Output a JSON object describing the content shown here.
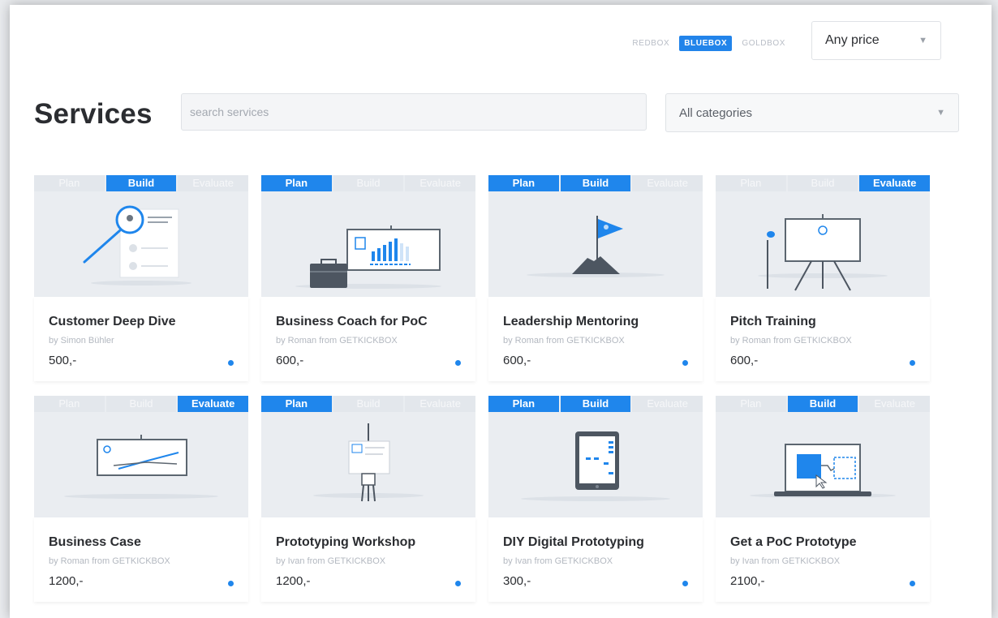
{
  "boxes": [
    {
      "label": "REDBOX",
      "active": false
    },
    {
      "label": "BLUEBOX",
      "active": true
    },
    {
      "label": "GOLDBOX",
      "active": false
    }
  ],
  "price_filter": {
    "value": "Any price"
  },
  "page_title": "Services",
  "search": {
    "placeholder": "search services"
  },
  "category_filter": {
    "value": "All categories"
  },
  "phase_labels": [
    "Plan",
    "Build",
    "Evaluate"
  ],
  "colors": {
    "accent": "#1f86ec"
  },
  "services": [
    {
      "title": "Customer Deep Dive",
      "author": "by Simon Bühler",
      "price": "500,-",
      "phases": [
        false,
        true,
        false
      ],
      "icon": "magnifier-profile-icon"
    },
    {
      "title": "Business Coach for PoC",
      "author": "by Roman from GETKICKBOX",
      "price": "600,-",
      "phases": [
        true,
        false,
        false
      ],
      "icon": "briefcase-chart-icon"
    },
    {
      "title": "Leadership Mentoring",
      "author": "by Roman from GETKICKBOX",
      "price": "600,-",
      "phases": [
        true,
        true,
        false
      ],
      "icon": "mountain-flag-icon"
    },
    {
      "title": "Pitch Training",
      "author": "by Roman from GETKICKBOX",
      "price": "600,-",
      "phases": [
        false,
        false,
        true
      ],
      "icon": "flipchart-microphone-icon"
    },
    {
      "title": "Business Case",
      "author": "by Roman from GETKICKBOX",
      "price": "1200,-",
      "phases": [
        false,
        false,
        true
      ],
      "icon": "line-chart-board-icon"
    },
    {
      "title": "Prototyping Workshop",
      "author": "by Ivan from GETKICKBOX",
      "price": "1200,-",
      "phases": [
        true,
        false,
        false
      ],
      "icon": "easel-workshop-icon"
    },
    {
      "title": "DIY Digital Prototyping",
      "author": "by Ivan from GETKICKBOX",
      "price": "300,-",
      "phases": [
        true,
        true,
        false
      ],
      "icon": "tablet-wireframe-icon"
    },
    {
      "title": "Get a PoC Prototype",
      "author": "by Ivan from GETKICKBOX",
      "price": "2100,-",
      "phases": [
        false,
        true,
        false
      ],
      "icon": "laptop-prototype-icon"
    }
  ]
}
